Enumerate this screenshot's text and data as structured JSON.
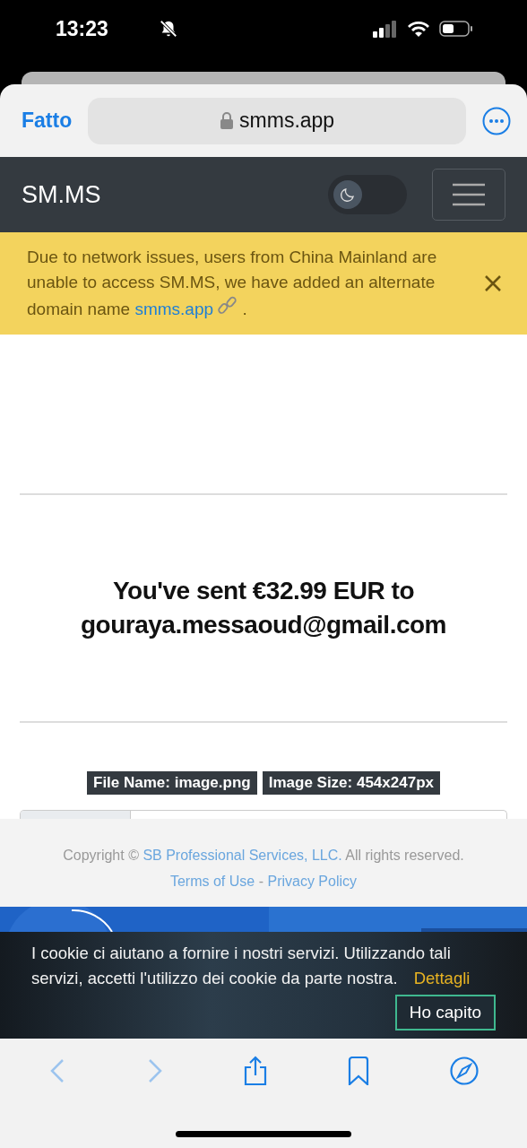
{
  "status_bar": {
    "time": "13:23",
    "silent": true
  },
  "browser": {
    "done": "Fatto",
    "address": "smms.app",
    "secure": true
  },
  "navbar": {
    "brand": "SM.MS",
    "dark_mode": {
      "on": false
    }
  },
  "alert": {
    "text": "Due to network issues, users from China Mainland are unable to access SM.MS, we have added an alternate domain name",
    "link": "smms.app",
    "end": "."
  },
  "image_text": [
    "You've sent €32.99 EUR to",
    "gouraya.messaoud@gmail.com"
  ],
  "badges": [
    "File Name: image.png",
    "Image Size: 454x247px"
  ],
  "footer": {
    "prefix": "Copyright ©",
    "company": "SB Professional Services, LLC.",
    "middle": "All rights reserved.",
    "terms": "Terms of Use",
    "separator": "-",
    "privacy": "Privacy Policy"
  },
  "cookie": {
    "text": "I cookie ci aiutano a fornire i nostri servizi. Utilizzando tali servizi, accetti l'utilizzo dei cookie da parte nostra.",
    "details": "Dettagli",
    "accept": "Ho capito"
  },
  "toolbar": {
    "back_enabled": false,
    "forward_enabled": false
  }
}
